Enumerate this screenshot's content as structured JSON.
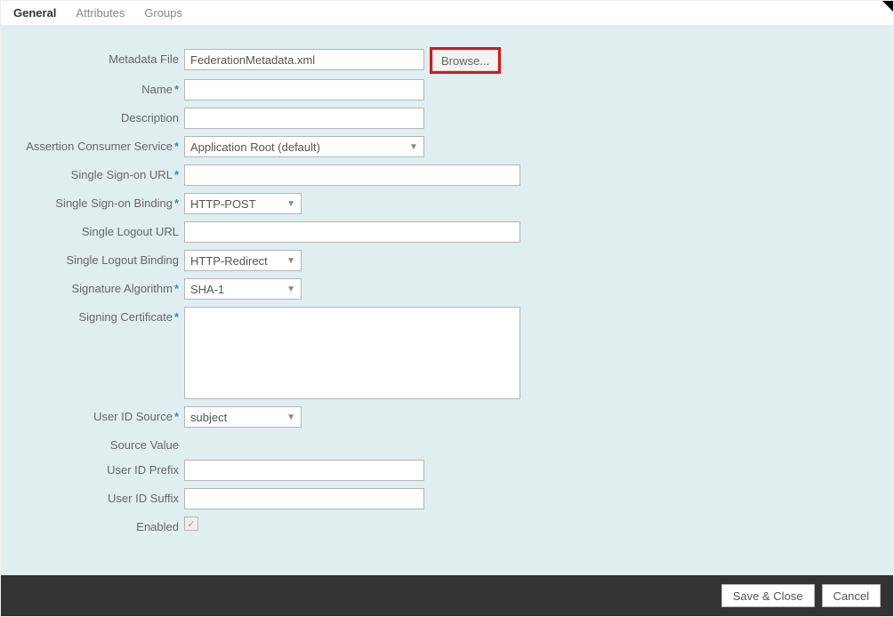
{
  "tabs": {
    "general": "General",
    "attributes": "Attributes",
    "groups": "Groups"
  },
  "labels": {
    "metadata_file": "Metadata File",
    "name": "Name",
    "description": "Description",
    "acs": "Assertion Consumer Service",
    "sso_url": "Single Sign-on URL",
    "sso_binding": "Single Sign-on Binding",
    "slo_url": "Single Logout URL",
    "slo_binding": "Single Logout Binding",
    "sig_alg": "Signature Algorithm",
    "signing_cert": "Signing Certificate",
    "uid_source": "User ID Source",
    "source_value": "Source Value",
    "uid_prefix": "User ID Prefix",
    "uid_suffix": "User ID Suffix",
    "enabled": "Enabled"
  },
  "values": {
    "metadata_file": "FederationMetadata.xml",
    "name": "",
    "description": "",
    "acs": "Application Root (default)",
    "sso_url": "",
    "sso_binding": "HTTP-POST",
    "slo_url": "",
    "slo_binding": "HTTP-Redirect",
    "sig_alg": "SHA-1",
    "signing_cert": "",
    "uid_source": "subject",
    "uid_prefix": "",
    "uid_suffix": "",
    "enabled": true
  },
  "buttons": {
    "browse": "Browse...",
    "save_close": "Save & Close",
    "cancel": "Cancel"
  },
  "required_marker": "*"
}
